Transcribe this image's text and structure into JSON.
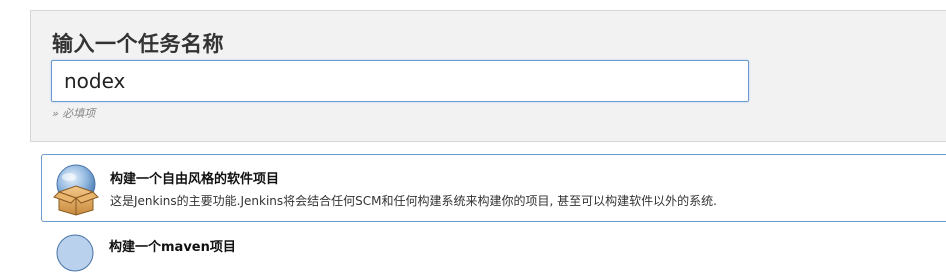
{
  "header": {
    "title": "输入一个任务名称",
    "name_input_value": "nodex",
    "required_hint": "» 必填项"
  },
  "job_types": [
    {
      "title": "构建一个自由风格的软件项目",
      "description": "这是Jenkins的主要功能.Jenkins将会结合任何SCM和任何构建系统来构建你的项目, 甚至可以构建软件以外的系统.",
      "icon": "freestyle-project-icon"
    },
    {
      "title": "构建一个maven项目",
      "icon": "maven-project-icon"
    }
  ],
  "colors": {
    "panel_bg": "#f2f2f2",
    "accent_border": "#6d9bd1"
  }
}
